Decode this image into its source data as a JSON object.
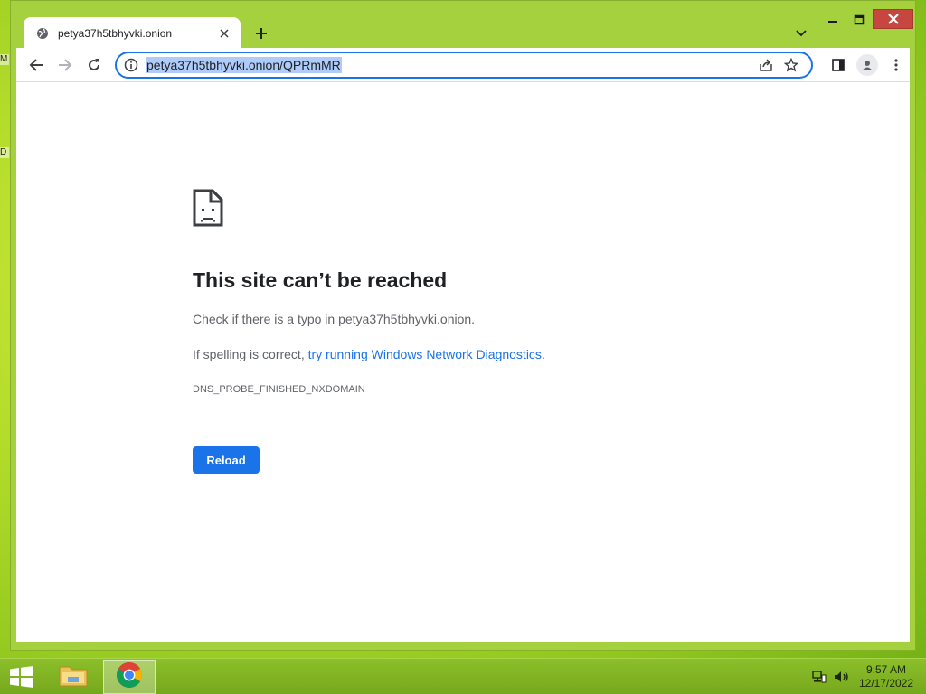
{
  "desktop": {
    "stub1": "M",
    "stub2": "D"
  },
  "browser": {
    "tab_title": "petya37h5tbhyvki.onion",
    "url": "petya37h5tbhyvki.onion/QPRmMR"
  },
  "error": {
    "title": "This site can’t be reached",
    "line1": "Check if there is a typo in petya37h5tbhyvki.onion.",
    "line2_prefix": "If spelling is correct, ",
    "line2_link": "try running Windows Network Diagnostics",
    "line2_suffix": ".",
    "code": "DNS_PROBE_FINISHED_NXDOMAIN",
    "reload_label": "Reload"
  },
  "taskbar": {
    "time": "9:57 AM",
    "date": "12/17/2022"
  },
  "colors": {
    "accent": "#1a73e8",
    "close_button": "#c7463f",
    "desktop": "#b4dc2a"
  }
}
